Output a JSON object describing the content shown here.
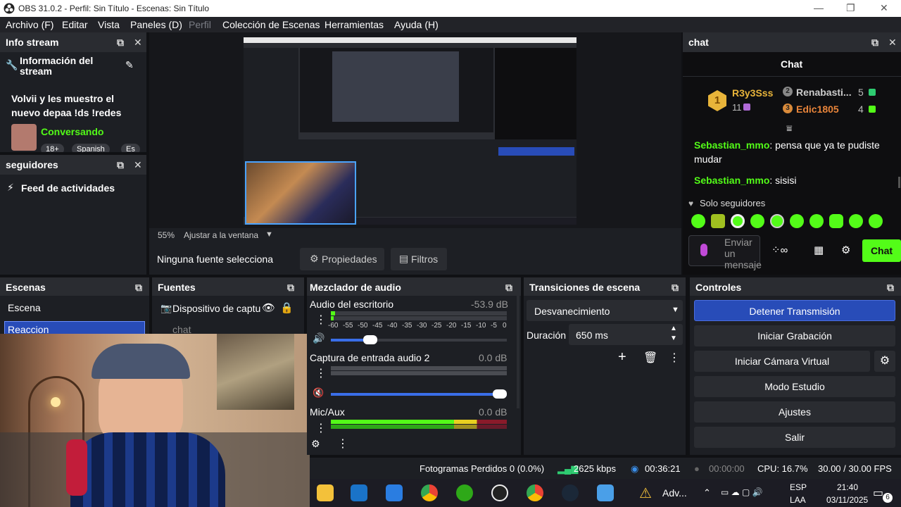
{
  "window": {
    "title": "OBS 31.0.2 - Perfil: Sin Título - Escenas: Sin Título"
  },
  "menu": [
    "Archivo (F)",
    "Editar",
    "Vista",
    "Paneles (D)",
    "Perfil",
    "Colección de Escenas",
    "Herramientas",
    "Ayuda (H)"
  ],
  "info_stream": {
    "dock_title": "Info stream",
    "heading": "Información del stream",
    "stream_title": "Volvii y les muestro el nuevo depaa !ds !redes",
    "category": "Conversando",
    "tags": [
      "18+",
      "Spanish",
      "Es"
    ]
  },
  "seguidores": {
    "dock_title": "seguidores",
    "feed": "Feed de actividades"
  },
  "preview": {
    "zoom": "55%",
    "zoom_mode": "Ajustar a la ventana"
  },
  "source_toolbar": {
    "no_source": "Ninguna fuente selecciona",
    "properties": "Propiedades",
    "filters": "Filtros"
  },
  "chat": {
    "dock_title": "chat",
    "header": "Chat",
    "leaderboard": [
      {
        "rank": "1",
        "name": "R3y3Sss",
        "count": "11"
      },
      {
        "rank": "2",
        "name": "Renabasti...",
        "count": "5"
      },
      {
        "rank": "3",
        "name": "Edic1805",
        "count": "4"
      }
    ],
    "messages": [
      {
        "user": "Sebastian_mmo",
        "text": "pensa que ya te pudiste mudar"
      },
      {
        "user": "Sebastian_mmo",
        "text": "sisisi"
      }
    ],
    "followers_only": "Solo seguidores",
    "input_placeholder": "Enviar un mensaje",
    "send_button": "Chat",
    "accent": "#53fc18"
  },
  "escenas": {
    "dock_title": "Escenas",
    "items": [
      "Escena",
      "Reaccion"
    ]
  },
  "fuentes": {
    "dock_title": "Fuentes",
    "items": [
      "Dispositivo de captu",
      "chat"
    ]
  },
  "mixer": {
    "dock_title": "Mezclador de audio",
    "channels": [
      {
        "name": "Audio del escritorio",
        "db": "-53.9 dB"
      },
      {
        "name": "Captura de entrada audio 2",
        "db": "0.0 dB"
      },
      {
        "name": "Mic/Aux",
        "db": "0.0 dB"
      }
    ],
    "scale": [
      "-60",
      "-55",
      "-50",
      "-45",
      "-40",
      "-35",
      "-30",
      "-25",
      "-20",
      "-15",
      "-10",
      "-5",
      "0"
    ]
  },
  "transitions": {
    "dock_title": "Transiciones de escena",
    "selected": "Desvanecimiento",
    "duration_label": "Duración",
    "duration_value": "650 ms"
  },
  "controls": {
    "dock_title": "Controles",
    "buttons": [
      "Detener Transmisión",
      "Iniciar Grabación",
      "Iniciar Cámara Virtual",
      "Modo Estudio",
      "Ajustes",
      "Salir"
    ],
    "active_color": "#284cb8"
  },
  "statusbar": {
    "dropped": "Fotogramas Perdidos 0 (0.0%)",
    "bitrate": "2625 kbps",
    "live_time": "00:36:21",
    "rec_time": "00:00:00",
    "cpu": "CPU: 16.7%",
    "fps": "30.00 / 30.00 FPS"
  },
  "taskbar": {
    "app_label": "Adv...",
    "lang": "ESP",
    "region": "LAA",
    "time": "21:40",
    "date": "03/11/2025",
    "notifications": "6"
  }
}
